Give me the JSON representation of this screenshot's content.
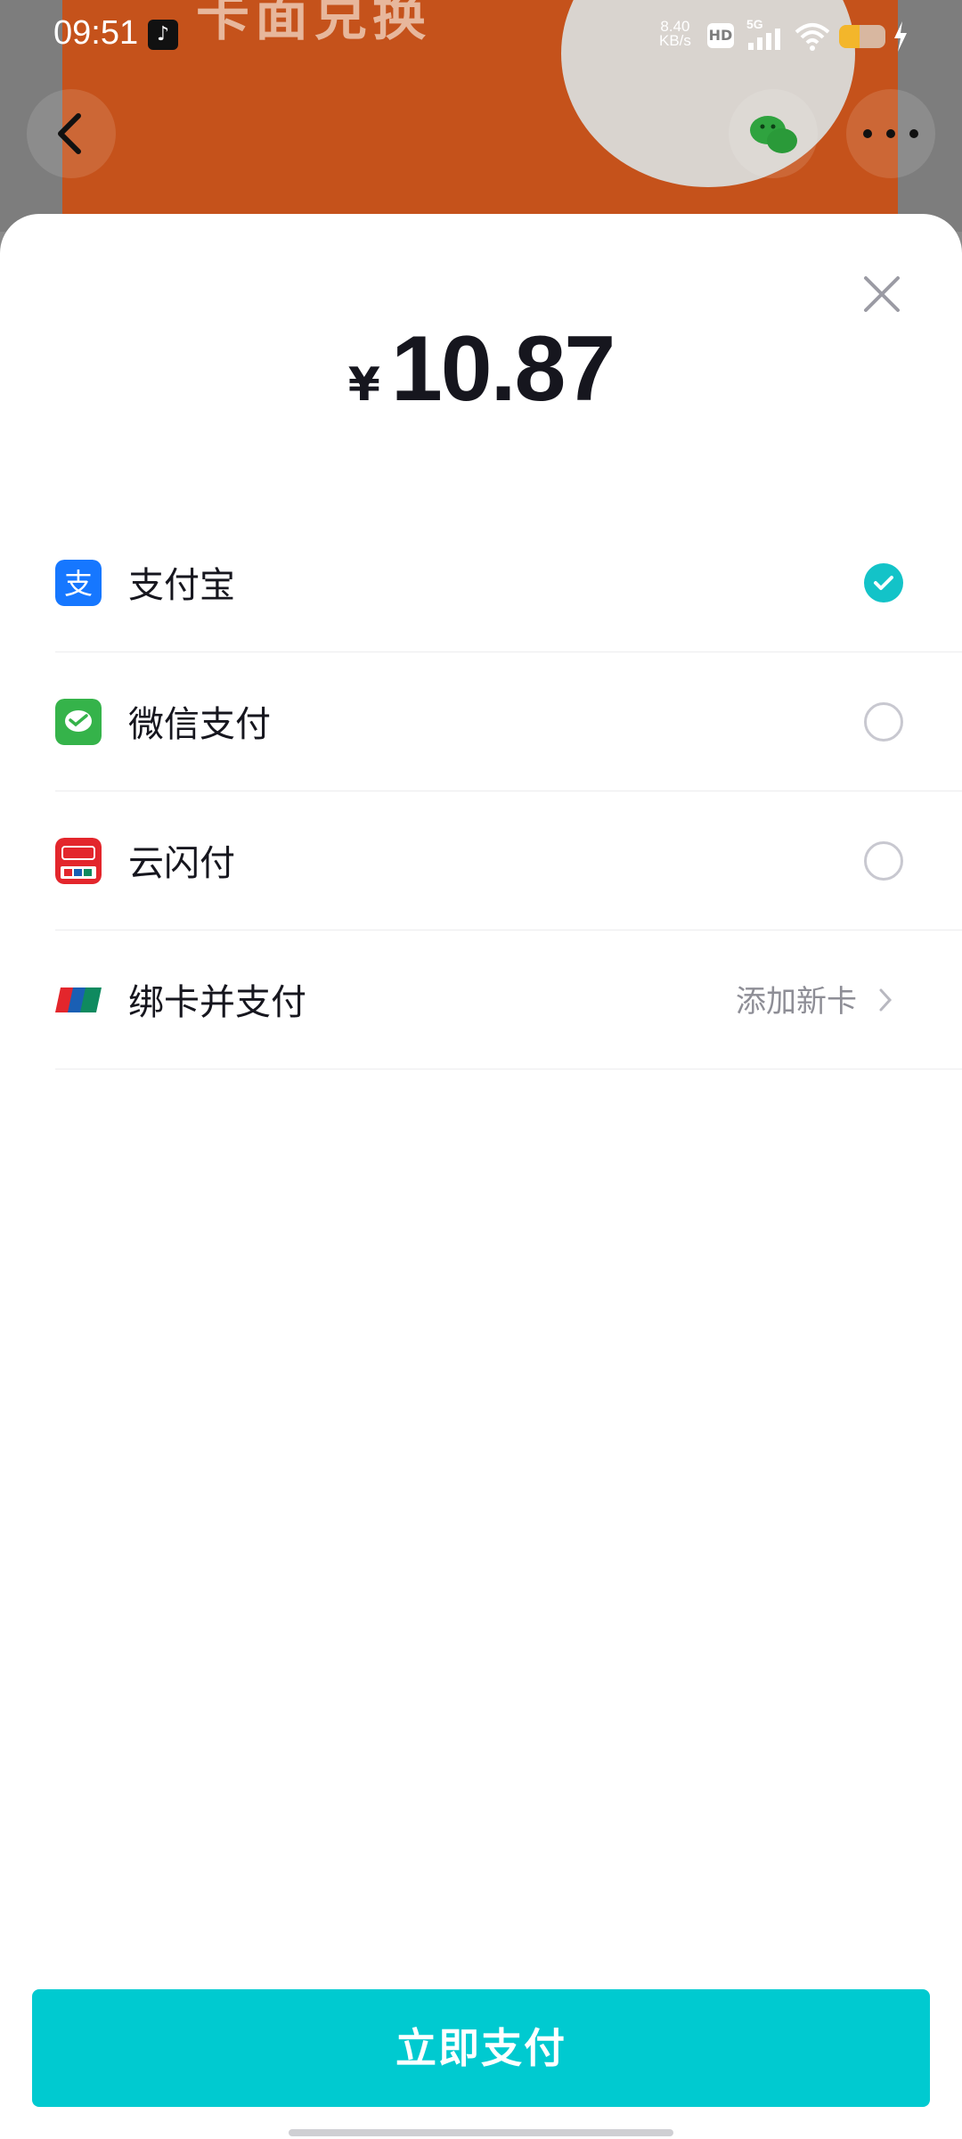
{
  "status_bar": {
    "time": "09:51",
    "net_speed_value": "8.40",
    "net_speed_unit": "KB/s",
    "hd": "HD",
    "network": "5G",
    "battery_level": 0.45
  },
  "background": {
    "banner_text": "卡面兑换",
    "accent": "#c5521b"
  },
  "sheet": {
    "amount": {
      "currency": "¥",
      "value": "10.87"
    },
    "methods": [
      {
        "label": "支付宝",
        "icon": "alipay-icon",
        "selected": true
      },
      {
        "label": "微信支付",
        "icon": "wechat-pay-icon",
        "selected": false
      },
      {
        "label": "云闪付",
        "icon": "cloud-quickpass-icon",
        "selected": false
      },
      {
        "label": "绑卡并支付",
        "icon": "unionpay-icon",
        "action": "添加新卡"
      }
    ],
    "pay_button": "立即支付"
  },
  "colors": {
    "accent": "#00cad0",
    "check": "#13c3c8",
    "alipay": "#1677ff",
    "wechat": "#35b34a",
    "quickpass": "#e3262c"
  }
}
